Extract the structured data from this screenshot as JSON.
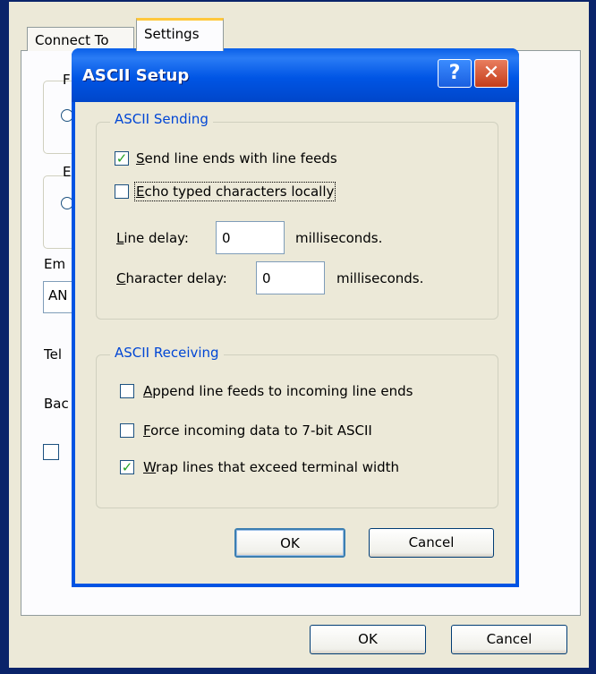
{
  "outer": {
    "tabs": [
      {
        "label": "Connect To"
      },
      {
        "label": "Settings"
      }
    ],
    "partial_labels": {
      "f": "F",
      "e": "E",
      "em": "Em",
      "an": "AN",
      "tel": "Tel",
      "bac": "Bac"
    },
    "buttons": {
      "ok": "OK",
      "cancel": "Cancel"
    }
  },
  "dialog": {
    "title": "ASCII Setup",
    "help_glyph": "?",
    "close_glyph": "✕",
    "sending": {
      "title": "ASCII Sending",
      "send_line_ends": {
        "label_underlined": "S",
        "label_rest": "end line ends with line feeds",
        "checked": true
      },
      "echo_typed": {
        "label_underlined": "E",
        "label_rest": "cho typed characters locally",
        "checked": false
      },
      "line_delay": {
        "label_underlined": "L",
        "label_rest": "ine delay:",
        "value": "0",
        "unit": "milliseconds."
      },
      "char_delay": {
        "label_underlined": "C",
        "label_rest": "haracter delay:",
        "value": "0",
        "unit": "milliseconds."
      }
    },
    "receiving": {
      "title": "ASCII Receiving",
      "append_lf": {
        "label_underlined": "A",
        "label_rest": "ppend line feeds to incoming line ends",
        "checked": false
      },
      "force_7bit": {
        "label_underlined": "F",
        "label_rest": "orce incoming data to 7-bit ASCII",
        "checked": false
      },
      "wrap_lines": {
        "label_underlined": "W",
        "label_rest": "rap lines that exceed terminal width",
        "checked": true
      }
    },
    "buttons": {
      "ok": "OK",
      "cancel": "Cancel"
    },
    "check_glyph": "✓"
  },
  "colors": {
    "titlebar": "#0054e3",
    "group_title": "#0046d5",
    "check": "#21a121"
  }
}
